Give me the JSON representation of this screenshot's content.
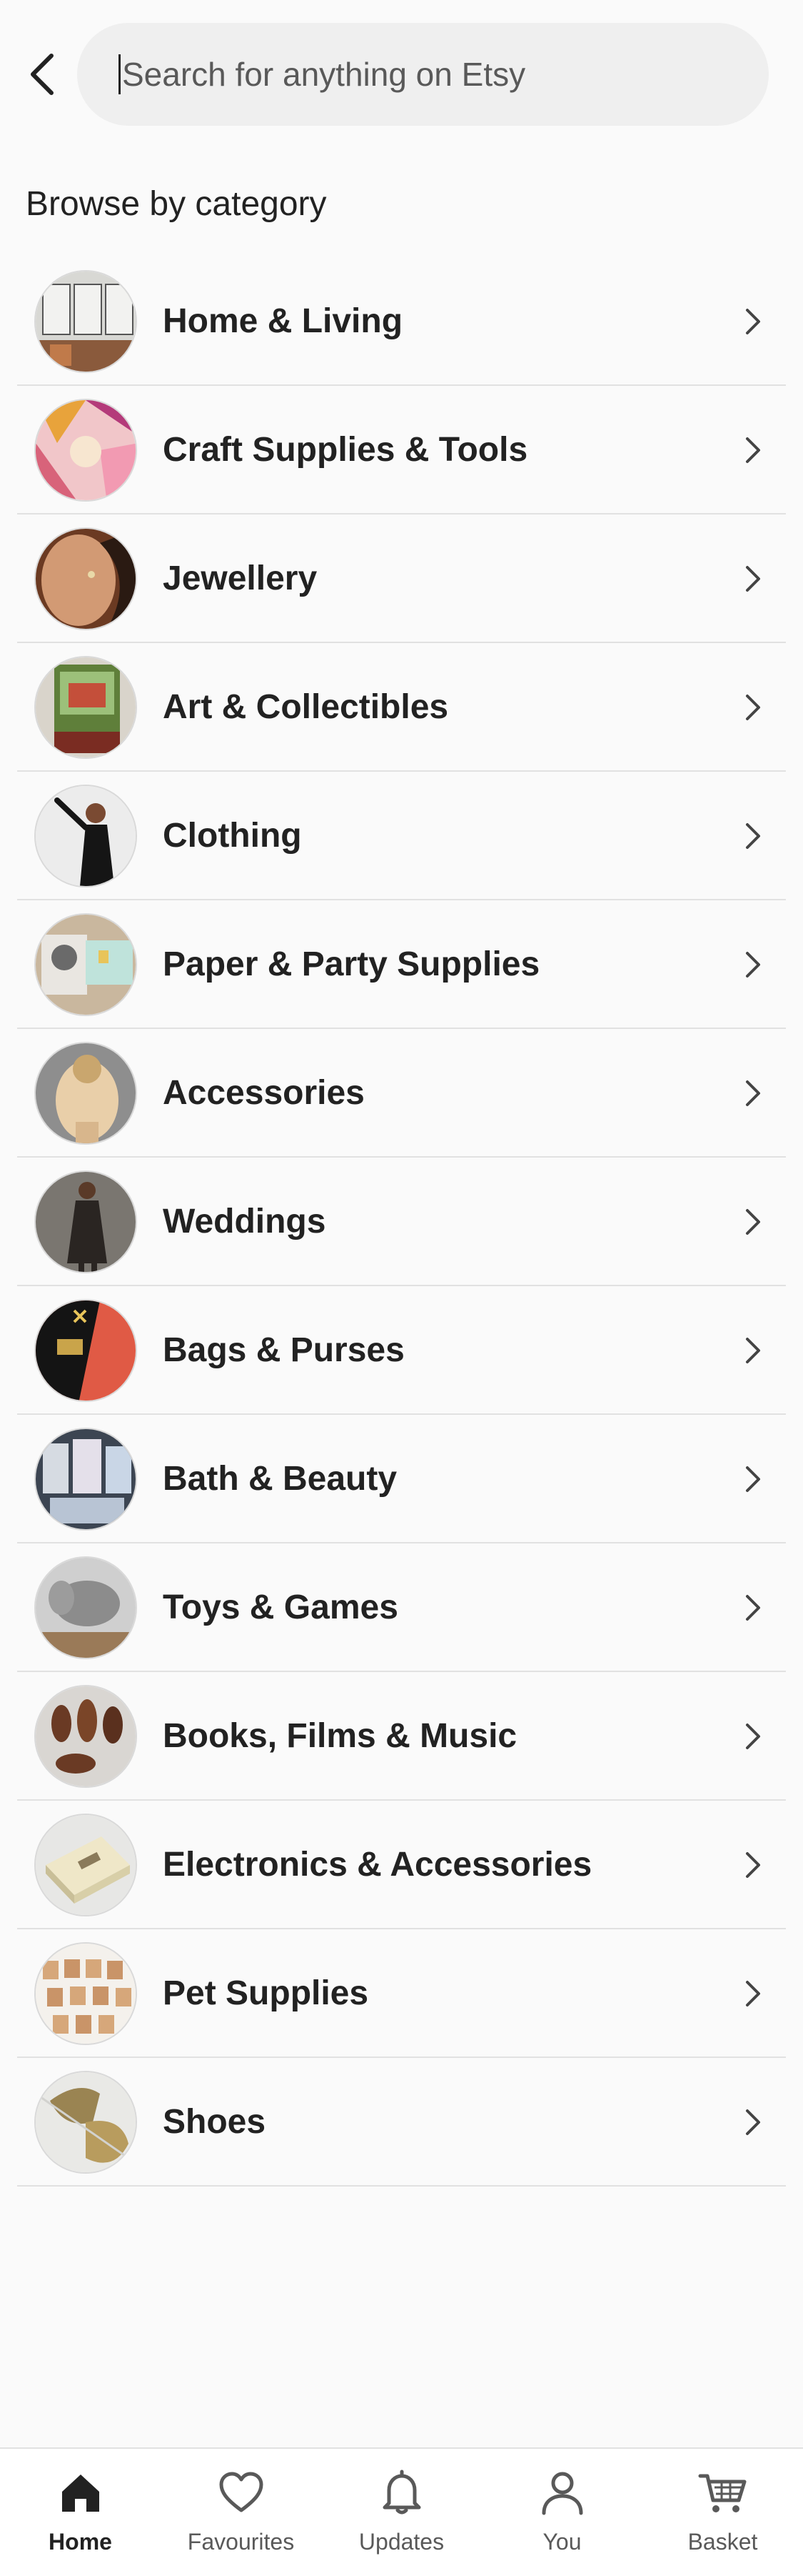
{
  "search": {
    "placeholder": "Search for anything on Etsy"
  },
  "section_title": "Browse by category",
  "categories": [
    {
      "label": "Home & Living"
    },
    {
      "label": "Craft Supplies & Tools"
    },
    {
      "label": "Jewellery"
    },
    {
      "label": "Art & Collectibles"
    },
    {
      "label": "Clothing"
    },
    {
      "label": "Paper & Party Supplies"
    },
    {
      "label": "Accessories"
    },
    {
      "label": "Weddings"
    },
    {
      "label": "Bags & Purses"
    },
    {
      "label": "Bath & Beauty"
    },
    {
      "label": "Toys & Games"
    },
    {
      "label": "Books, Films & Music"
    },
    {
      "label": "Electronics & Accessories"
    },
    {
      "label": "Pet Supplies"
    },
    {
      "label": "Shoes"
    }
  ],
  "nav": {
    "items": [
      {
        "label": "Home",
        "icon": "home-icon",
        "active": true
      },
      {
        "label": "Favourites",
        "icon": "heart-icon"
      },
      {
        "label": "Updates",
        "icon": "bell-icon"
      },
      {
        "label": "You",
        "icon": "person-icon"
      },
      {
        "label": "Basket",
        "icon": "cart-icon"
      }
    ]
  },
  "colors": {
    "background": "#fafafa",
    "text": "#222222",
    "muted": "#595959",
    "search_bg": "#efefef",
    "divider": "#e1e1e1"
  }
}
